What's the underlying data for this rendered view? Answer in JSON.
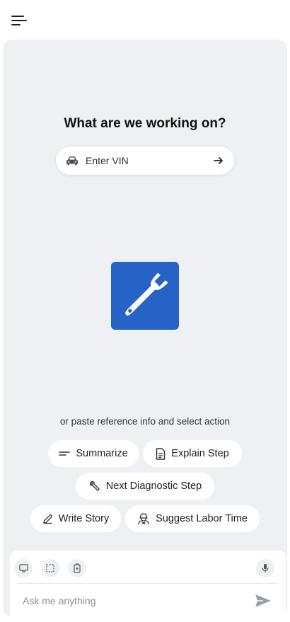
{
  "header": {
    "menu_icon": "hamburger-menu-icon"
  },
  "main": {
    "headline": "What are we working on?",
    "vin": {
      "placeholder": "Enter VIN",
      "icon": "car-icon",
      "submit_icon": "arrow-right-icon"
    },
    "logo_icon": "wrench-icon",
    "logo_color": "#2563c7",
    "hint": "or paste reference info and select action",
    "actions": [
      {
        "label": "Summarize",
        "icon": "lines-icon"
      },
      {
        "label": "Explain Step",
        "icon": "document-icon"
      },
      {
        "label": "Next Diagnostic Step",
        "icon": "wrench-icon"
      },
      {
        "label": "Write Story",
        "icon": "pencil-icon"
      },
      {
        "label": "Suggest Labor Time",
        "icon": "mechanic-icon"
      }
    ]
  },
  "composer": {
    "tools": [
      "screen-icon",
      "selection-icon",
      "battery-icon"
    ],
    "mic_icon": "microphone-icon",
    "placeholder": "Ask me anything",
    "send_icon": "send-icon"
  }
}
